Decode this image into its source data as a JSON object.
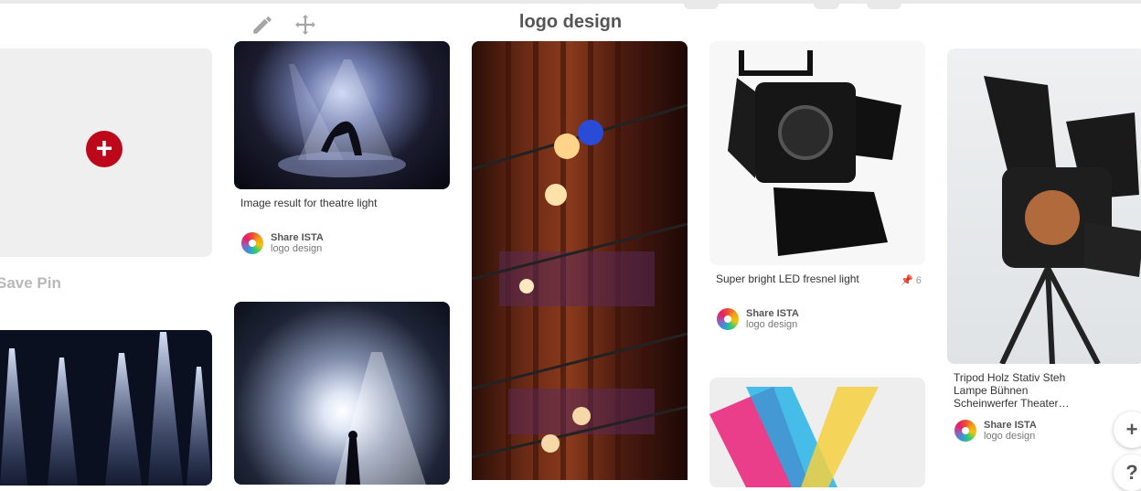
{
  "header": {
    "title": "logo design",
    "edit_icon": "pencil-icon",
    "move_icon": "move-arrows-icon"
  },
  "save_card": {
    "label": "Save Pin",
    "add_icon": "plus-circle-icon"
  },
  "pins": [
    {
      "title": "Image result for theatre light",
      "pinner": "Share ISTA",
      "board": "logo design"
    },
    {
      "title": "Super bright LED fresnel light",
      "pinner": "Share ISTA",
      "board": "logo design",
      "repins": "6"
    },
    {
      "title": "Tripod Holz Stativ Steh Lampe Bühnen Scheinwerfer Theater…",
      "pinner": "Share ISTA",
      "board": "logo design"
    }
  ],
  "floating": {
    "add": "+",
    "help": "?"
  },
  "colors": {
    "brand_red": "#bd081c",
    "placeholder": "#efefef"
  }
}
